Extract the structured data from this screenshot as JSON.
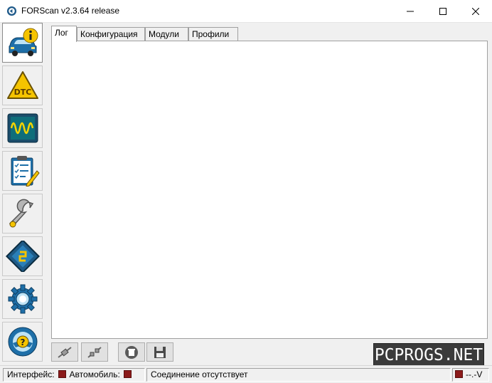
{
  "window": {
    "title": "FORScan v2.3.64 release",
    "controls": {
      "minimize": "–",
      "maximize": "☐",
      "close": "✕"
    }
  },
  "sidebar": {
    "items": [
      {
        "id": "info",
        "icon": "car-info-icon",
        "active": true
      },
      {
        "id": "dtc",
        "icon": "dtc-warning-icon",
        "active": false
      },
      {
        "id": "oscilloscope",
        "icon": "oscilloscope-icon",
        "active": false
      },
      {
        "id": "tests",
        "icon": "checklist-icon",
        "active": false
      },
      {
        "id": "service",
        "icon": "wrench-icon",
        "active": false
      },
      {
        "id": "config",
        "icon": "chip-icon",
        "active": false
      },
      {
        "id": "settings",
        "icon": "gear-icon",
        "active": false
      },
      {
        "id": "help",
        "icon": "help-wheel-icon",
        "active": false
      }
    ]
  },
  "tabs": [
    {
      "label": "Лог",
      "active": true
    },
    {
      "label": "Конфигурация",
      "active": false
    },
    {
      "label": "Модули",
      "active": false
    },
    {
      "label": "Профили",
      "active": false
    }
  ],
  "toolbar": {
    "buttons": [
      {
        "icon": "connect-icon"
      },
      {
        "icon": "disconnect-icon"
      },
      {
        "icon": "clear-log-icon"
      },
      {
        "icon": "save-disk-icon"
      }
    ]
  },
  "watermark": {
    "text": "PCPROGS.NET"
  },
  "status": {
    "interface_label": "Интерфейс:",
    "vehicle_label": "Автомобиль:",
    "connection_text": "Соединение отсутствует",
    "voltage_text": "--.-V",
    "indicator_color": "#8b1a1a"
  }
}
